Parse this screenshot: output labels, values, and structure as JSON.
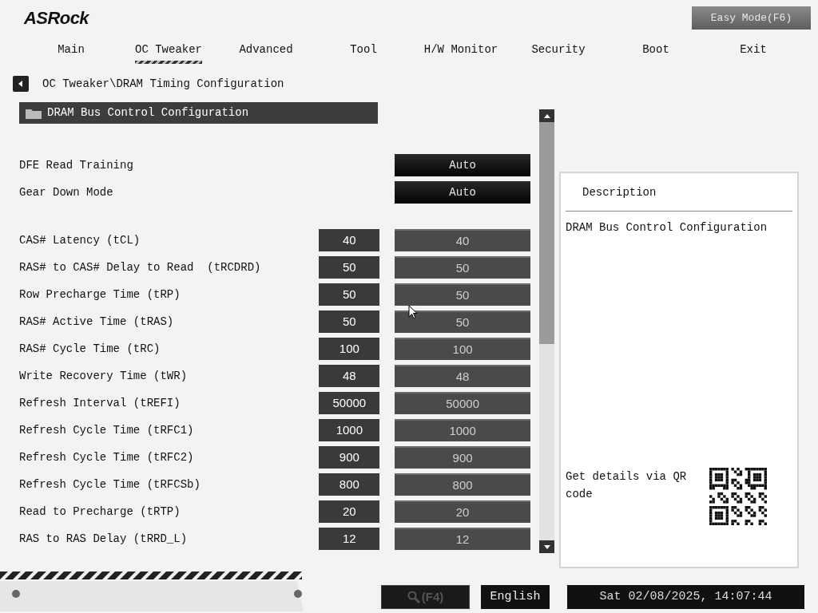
{
  "header": {
    "logo": "ASRock",
    "easy_mode_button": "Easy Mode(F6)"
  },
  "tabs": [
    {
      "label": "Main",
      "selected": false
    },
    {
      "label": "OC Tweaker",
      "selected": true
    },
    {
      "label": "Advanced",
      "selected": false
    },
    {
      "label": "Tool",
      "selected": false
    },
    {
      "label": "H/W Monitor",
      "selected": false
    },
    {
      "label": "Security",
      "selected": false
    },
    {
      "label": "Boot",
      "selected": false
    },
    {
      "label": "Exit",
      "selected": false
    }
  ],
  "breadcrumb": "OC Tweaker\\DRAM Timing Configuration",
  "section": {
    "title": "DRAM Bus Control Configuration",
    "selected": true
  },
  "setting_groups": [
    [
      {
        "kind": "option",
        "label": "DFE Read Training",
        "value": "Auto"
      },
      {
        "kind": "option",
        "label": "Gear Down Mode",
        "value": "Auto"
      }
    ],
    [
      {
        "kind": "timing",
        "label": "CAS# Latency (tCL)",
        "current": "40",
        "value": "40"
      },
      {
        "kind": "timing",
        "label": "RAS# to CAS# Delay to Read  (tRCDRD)",
        "current": "50",
        "value": "50"
      },
      {
        "kind": "timing",
        "label": "Row Precharge Time (tRP)",
        "current": "50",
        "value": "50"
      },
      {
        "kind": "timing",
        "label": "RAS# Active Time (tRAS)",
        "current": "50",
        "value": "50"
      },
      {
        "kind": "timing",
        "label": "RAS# Cycle Time (tRC)",
        "current": "100",
        "value": "100"
      },
      {
        "kind": "timing",
        "label": "Write Recovery Time (tWR)",
        "current": "48",
        "value": "48"
      },
      {
        "kind": "timing",
        "label": "Refresh Interval (tREFI)",
        "current": "50000",
        "value": "50000"
      },
      {
        "kind": "timing",
        "label": "Refresh Cycle Time (tRFC1)",
        "current": "1000",
        "value": "1000"
      },
      {
        "kind": "timing",
        "label": "Refresh Cycle Time (tRFC2)",
        "current": "900",
        "value": "900"
      },
      {
        "kind": "timing",
        "label": "Refresh Cycle Time (tRFCSb)",
        "current": "800",
        "value": "800"
      },
      {
        "kind": "timing",
        "label": "Read to Precharge (tRTP)",
        "current": "20",
        "value": "20"
      },
      {
        "kind": "timing",
        "label": "RAS to RAS Delay (tRRD_L)",
        "current": "12",
        "value": "12"
      }
    ]
  ],
  "description": {
    "heading": "Description",
    "text": "DRAM Bus Control Configuration",
    "qr_hint": "Get details via QR code"
  },
  "footer": {
    "search_button": "(F4)",
    "language": "English",
    "datetime": "Sat 02/08/2025, 14:07:44"
  }
}
